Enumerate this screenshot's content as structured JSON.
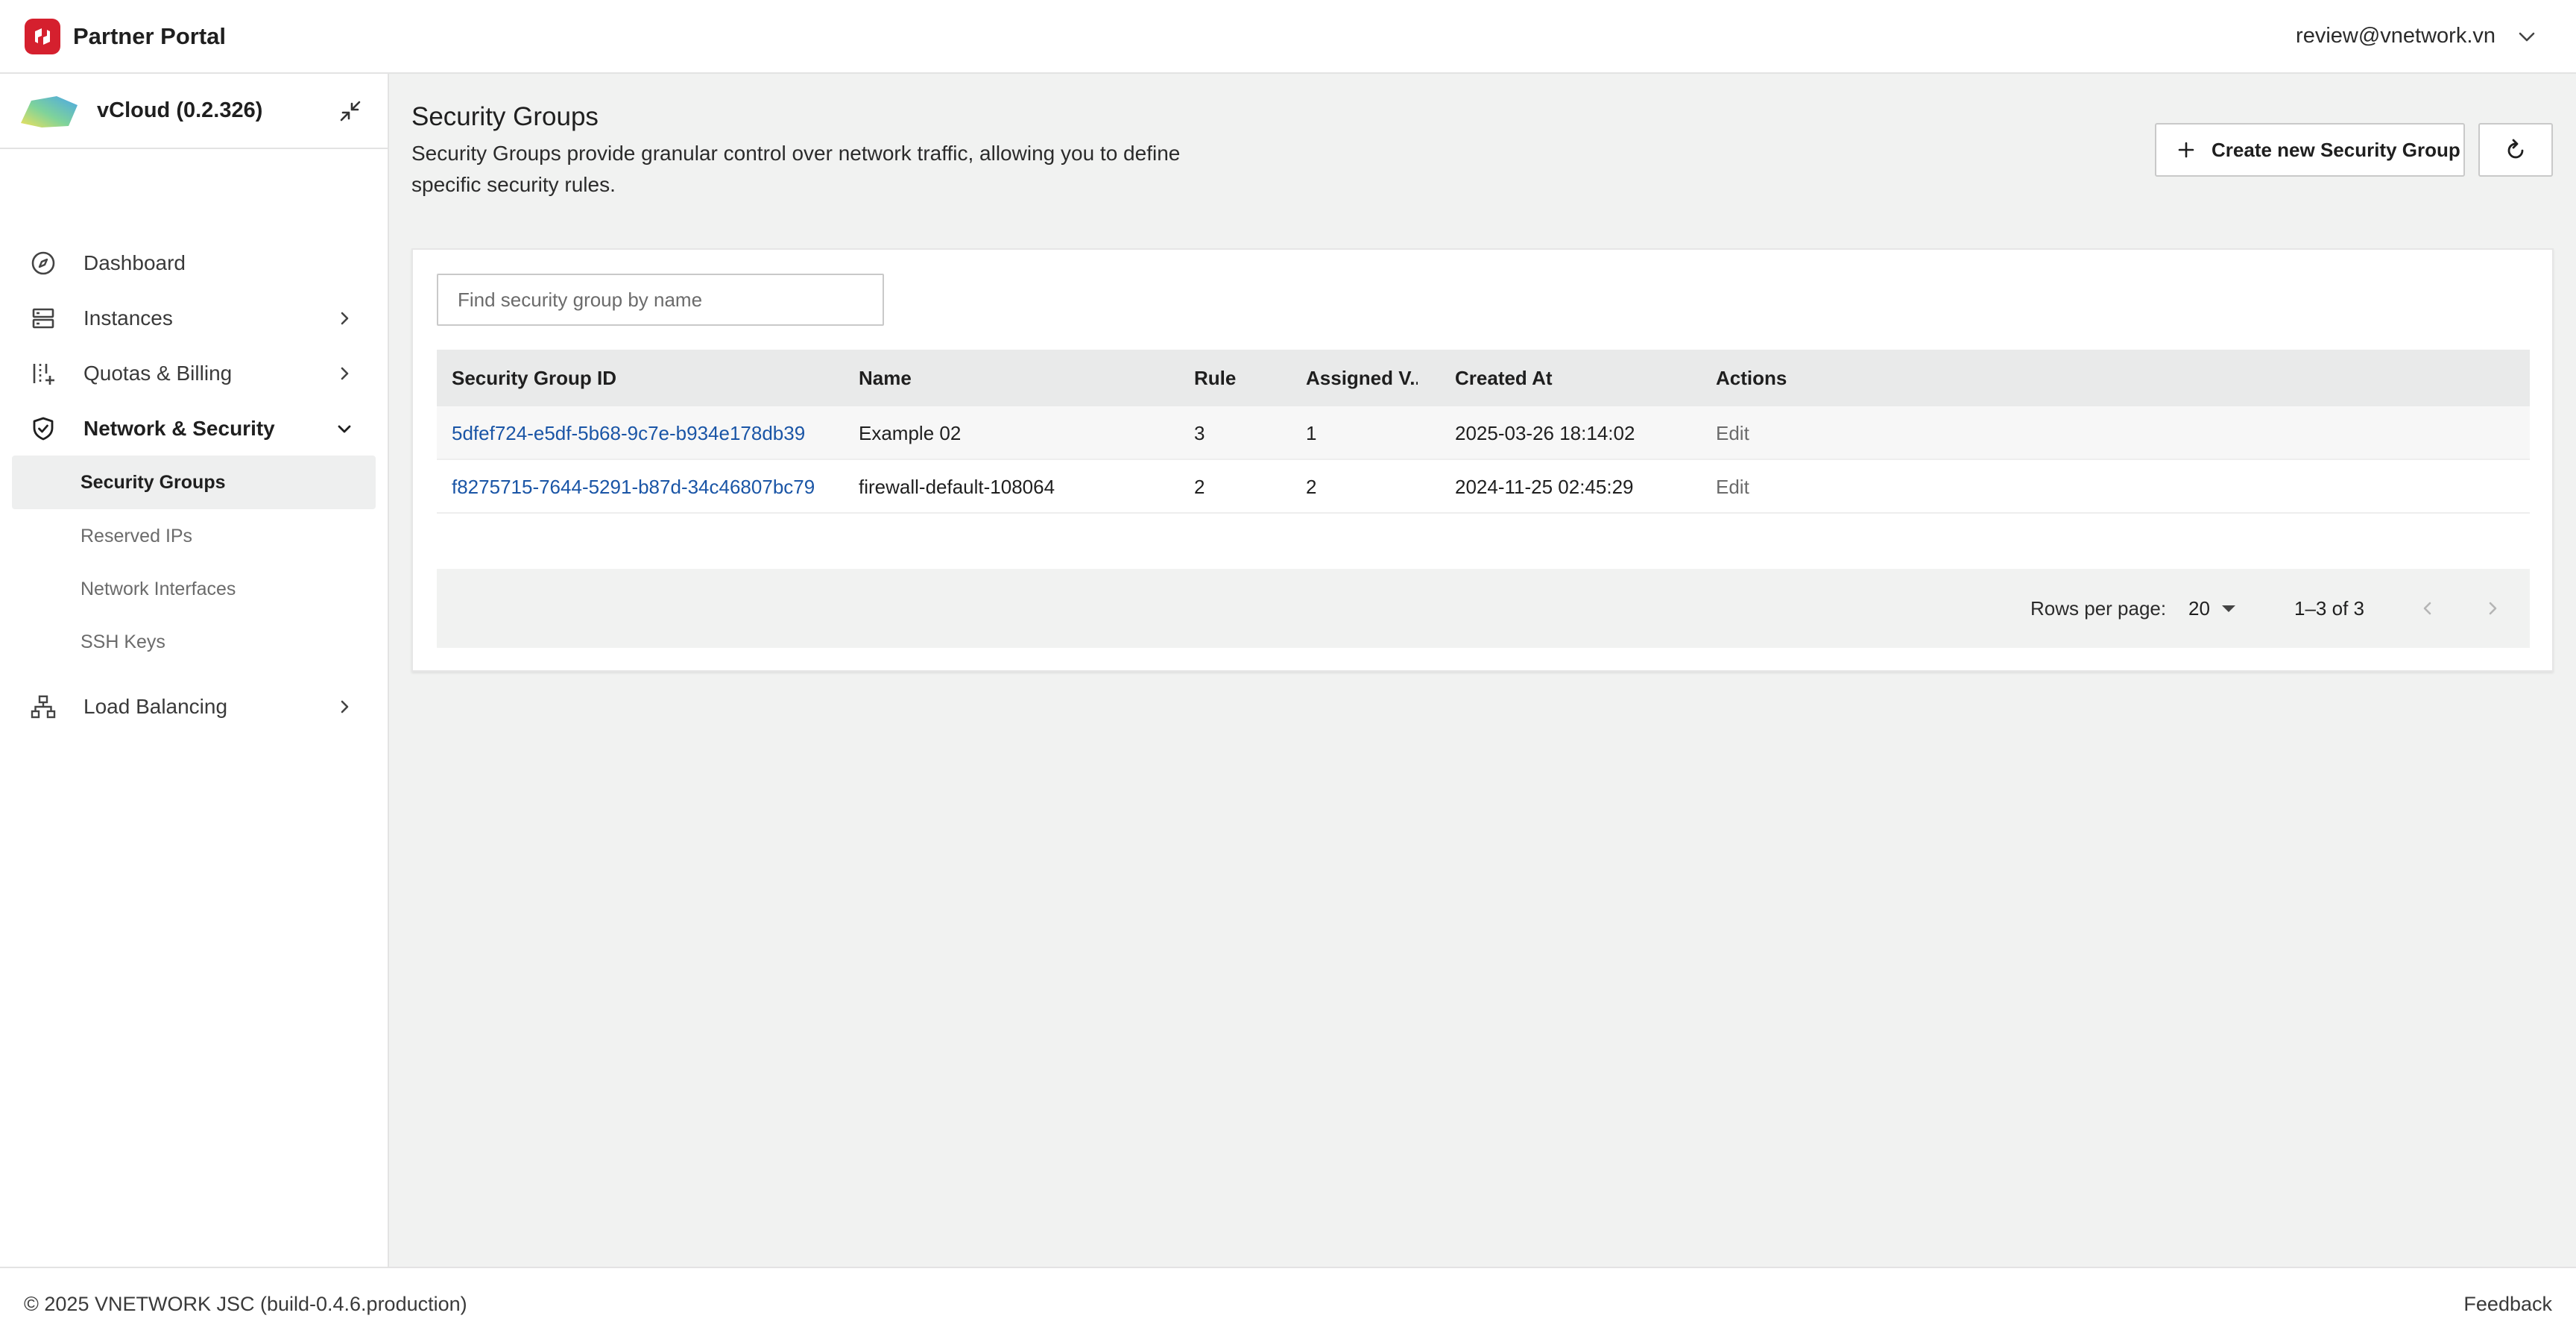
{
  "header": {
    "brand_name": "Partner Portal",
    "brand_color": "#d5202e",
    "user_email": "review@vnetwork.vn"
  },
  "sidebar": {
    "project_name": "vCloud (0.2.326)",
    "items": [
      {
        "label": "Dashboard",
        "icon": "compass-icon"
      },
      {
        "label": "Instances",
        "icon": "server-icon"
      },
      {
        "label": "Quotas & Billing",
        "icon": "quota-icon"
      },
      {
        "label": "Network & Security",
        "icon": "shield-check-icon",
        "expanded": true
      },
      {
        "label": "Load Balancing",
        "icon": "sitemap-icon"
      }
    ],
    "network_sub": [
      {
        "label": "Security Groups",
        "active": true
      },
      {
        "label": "Reserved IPs"
      },
      {
        "label": "Network Interfaces"
      },
      {
        "label": "SSH Keys"
      }
    ]
  },
  "main": {
    "title": "Security Groups",
    "description": "Security Groups provide granular control over network traffic, allowing you to define specific security rules.",
    "create_button": "Create new Security Group",
    "search_placeholder": "Find security group by name",
    "table": {
      "columns": [
        "Security Group ID",
        "Name",
        "Rule",
        "Assigned V...",
        "Created At",
        "Actions"
      ],
      "rows": [
        {
          "id": "5dfef724-e5df-5b68-9c7e-b934e178db39",
          "name": "Example 02",
          "rule": "3",
          "assigned": "1",
          "created_at": "2025-03-26 18:14:02",
          "action": "Edit"
        },
        {
          "id": "f8275715-7644-5291-b87d-34c46807bc79",
          "name": "firewall-default-108064",
          "rule": "2",
          "assigned": "2",
          "created_at": "2024-11-25 02:45:29",
          "action": "Edit"
        }
      ]
    },
    "pagination": {
      "rows_per_page_label": "Rows per page:",
      "rows_per_page": "20",
      "range": "1–3 of 3"
    }
  },
  "footer": {
    "copyright": "© 2025 VNETWORK JSC (build-0.4.6.production)",
    "feedback": "Feedback"
  },
  "colors": {
    "link": "#1a55a6",
    "page_background": "#f1f2f1",
    "table_header": "#e9eaea"
  }
}
